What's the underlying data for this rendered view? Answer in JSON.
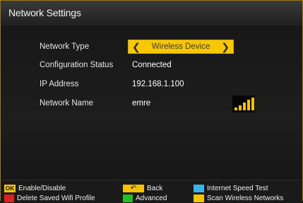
{
  "header": {
    "title": "Network Settings"
  },
  "rows": [
    {
      "label": "Network Type",
      "value": "Wireless Device"
    },
    {
      "label": "Configuration Status",
      "value": "Connected"
    },
    {
      "label": "IP Address",
      "value": "192.168.1.100"
    },
    {
      "label": "Network Name",
      "value": "emre"
    }
  ],
  "signal": {
    "bars_filled": 5,
    "bars_total": 5,
    "color": "#f3c300"
  },
  "footer": {
    "ok_badge": "OK",
    "enable_disable": "Enable/Disable",
    "delete_profile": "Delete Saved Wifi Profile",
    "back": "Back",
    "advanced": "Advanced",
    "speed_test": "Internet Speed Test",
    "scan": "Scan Wireless Networks"
  },
  "colors": {
    "accent": "#f7c800",
    "red_key": "#e02020",
    "green_key": "#21c21f",
    "blue_key": "#39b6e6",
    "yellow_key": "#f2c500"
  }
}
